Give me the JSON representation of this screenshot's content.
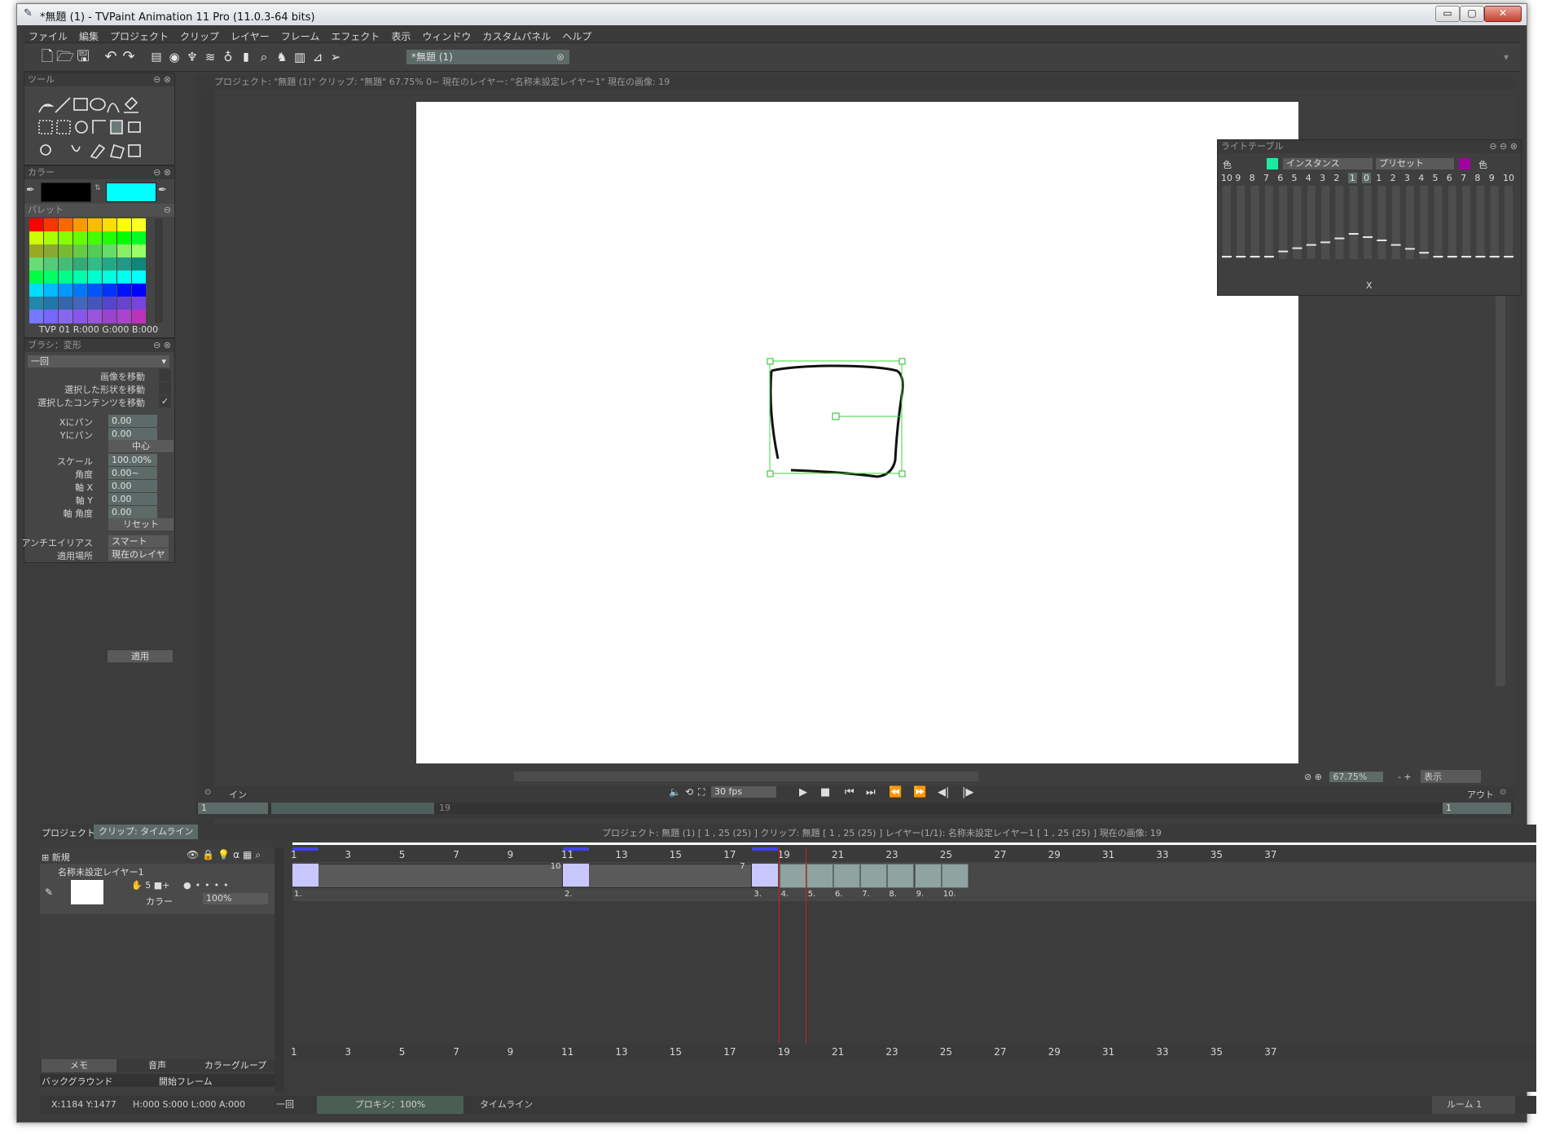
{
  "window": {
    "title": "*無題 (1) - TVPaint Animation 11 Pro (11.0.3-64 bits)",
    "buttons": {
      "minimize": "▭",
      "maximize": "▢",
      "close": "✕"
    }
  },
  "menu": [
    "ファイル",
    "編集",
    "プロジェクト",
    "クリップ",
    "レイヤー",
    "フレーム",
    "エフェクト",
    "表示",
    "ウィンドウ",
    "カスタムパネル",
    "ヘルプ"
  ],
  "toolbar": {
    "doc_tab": "*無題 (1)"
  },
  "tools_panel": {
    "title": "ツール"
  },
  "color_panel": {
    "title": "カラー",
    "palette_title": "パレット",
    "primary": "#000000",
    "secondary": "#00ffff",
    "readout": "TVP 01 R:000 G:000 B:000"
  },
  "brush_panel": {
    "title": "ブラシ：変形",
    "mode": "一回",
    "checks": [
      {
        "label": "画像を移動",
        "checked": ""
      },
      {
        "label": "選択した形状を移動",
        "checked": ""
      },
      {
        "label": "選択したコンテンツを移動",
        "checked": "✓"
      }
    ],
    "fields": [
      {
        "label": "Xにパン",
        "value": "0.00"
      },
      {
        "label": "Yにパン",
        "value": "0.00"
      }
    ],
    "center_button": "中心",
    "fields2": [
      {
        "label": "スケール",
        "value": "100.00%"
      },
      {
        "label": "角度",
        "value": "0.00~"
      },
      {
        "label": "軸 X",
        "value": "0.00"
      },
      {
        "label": "軸 Y",
        "value": "0.00"
      },
      {
        "label": "軸 角度",
        "value": "0.00"
      }
    ],
    "reset_button": "リセット",
    "antialias_label": "アンチエイリアス",
    "antialias_value": "スマート",
    "apply_to_label": "適用場所",
    "apply_to_value": "現在のレイヤ",
    "apply_button": "適用"
  },
  "viewport": {
    "header": "プロジェクト: \"無題 (1)\"  クリップ: \"無題\"  67.75%  0~  現在のレイヤー: \"名称未設定レイヤー1\"  現在の画像: 19",
    "zoom": "67.75%",
    "display_button": "表示"
  },
  "lighttable": {
    "title": "ライトテーブル",
    "color_left": "色",
    "instance": "インスタンス",
    "preset": "プリセット",
    "color_right": "色",
    "left_nums": [
      "10",
      "9",
      "8",
      "7",
      "6",
      "5",
      "4",
      "3",
      "2",
      "1"
    ],
    "center_num": "0",
    "right_nums": [
      "1",
      "2",
      "3",
      "4",
      "5",
      "6",
      "7",
      "8",
      "9",
      "10"
    ],
    "x_label": "X",
    "levels_left": [
      0,
      0,
      0,
      0,
      0.08,
      0.13,
      0.18,
      0.22,
      0.28
    ],
    "levels_right": [
      0.3,
      0.25,
      0.18,
      0.12,
      0.06,
      0,
      0,
      0,
      0,
      0
    ]
  },
  "transport": {
    "in_label": "イン",
    "out_label": "アウト",
    "fps": "30 fps",
    "in_value": "1",
    "out_value": "1",
    "marker": "19"
  },
  "timeline": {
    "tabs": [
      "プロジェクト",
      "クリップ: タイムライン"
    ],
    "info": "プロジェクト: 無題 (1) [ 1 , 25  (25) ]     クリップ: 無題 [ 1 , 25  (25) ]     レイヤー(1/1): 名称未設定レイヤー1 [ 1 , 25  (25) ]     現在の画像: 19",
    "new_label": "新規",
    "layer_name": "名称未設定レイヤー1",
    "color_label": "カラー",
    "opacity": "100%",
    "frame_numbers": [
      "1",
      "3",
      "5",
      "7",
      "9",
      "11",
      "13",
      "15",
      "17",
      "19",
      "21",
      "23",
      "25",
      "27",
      "29",
      "31",
      "33",
      "35",
      "37"
    ],
    "instance_labels": [
      "1.",
      "2.",
      "3.",
      "4.",
      "5.",
      "6.",
      "7.",
      "8.",
      "9.",
      "10."
    ],
    "hold_labels": [
      "10",
      "7"
    ],
    "bottom_tabs": [
      "メモ",
      "音声",
      "カラーグループ"
    ],
    "background_label": "バックグラウンド",
    "start_frame_label": "開始フレーム"
  },
  "status": {
    "coords": "X:1184  Y:1477",
    "color": "H:000 S:000 L:000 A:000",
    "mode": "一回",
    "proxy": "プロキシ：100%",
    "timeline": "タイムライン",
    "room": "ルーム 1"
  }
}
